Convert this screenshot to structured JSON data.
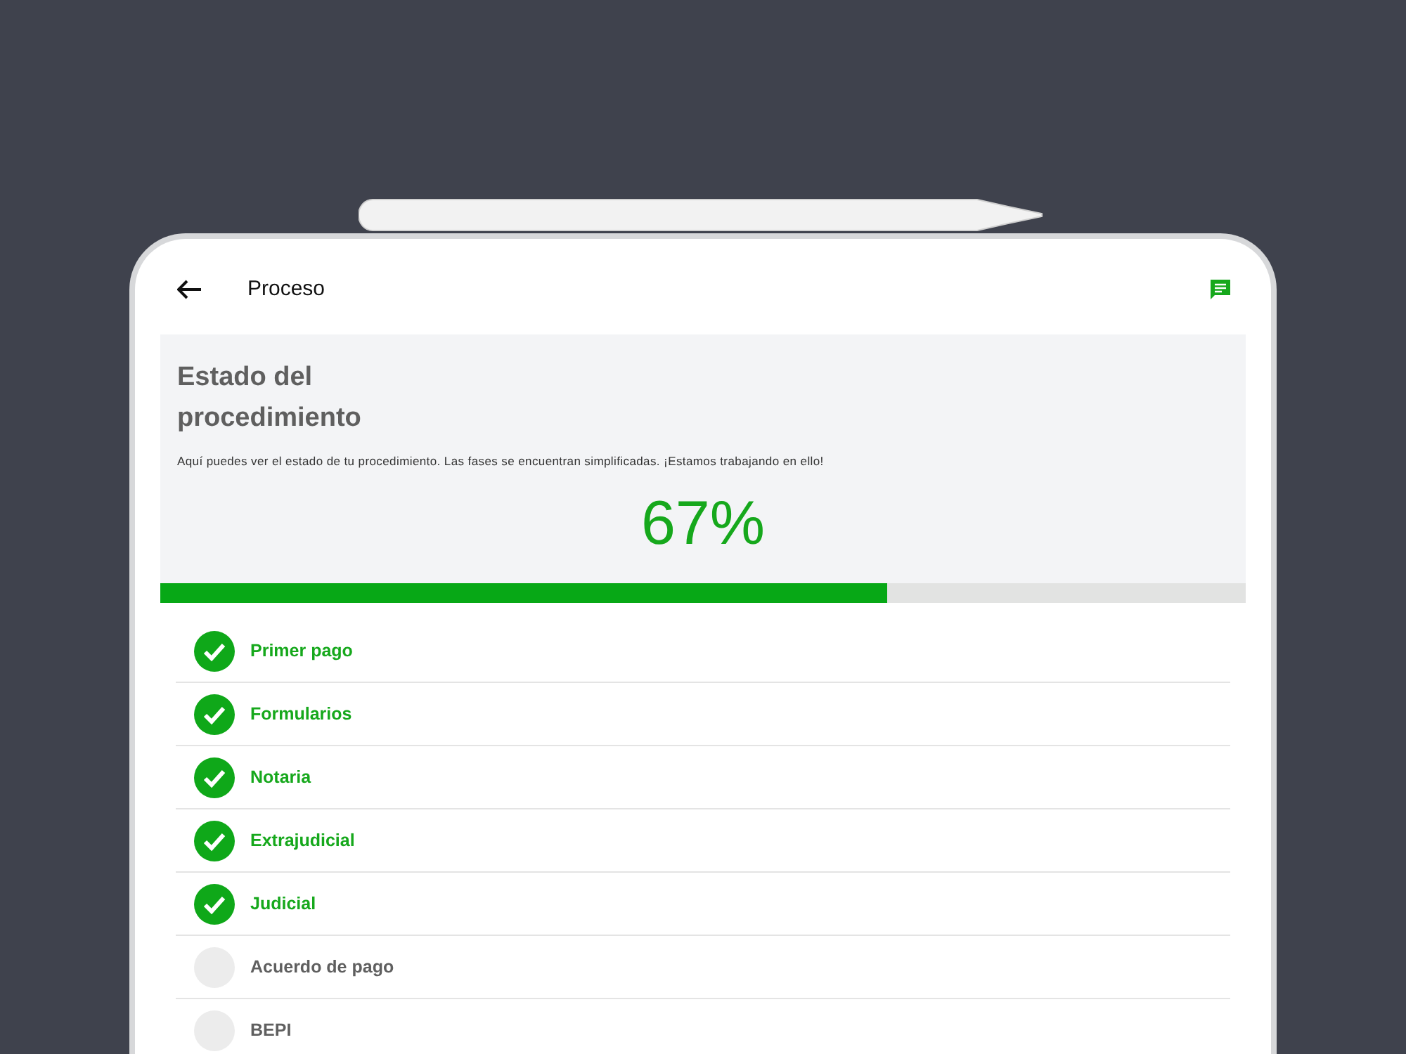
{
  "header": {
    "title": "Proceso"
  },
  "status": {
    "title": "Estado del procedimiento",
    "description": "Aquí puedes ver el estado de tu procedimiento. Las fases se encuentran simplificadas. ¡Estamos trabajando en ello!",
    "percent": "67%"
  },
  "progress": {
    "level": 0.67
  },
  "phases": [
    {
      "label": "Primer pago",
      "done": true
    },
    {
      "label": "Formularios",
      "done": true
    },
    {
      "label": "Notaria",
      "done": true
    },
    {
      "label": "Extrajudicial",
      "done": true
    },
    {
      "label": "Judicial",
      "done": true
    },
    {
      "label": "Acuerdo de pago",
      "done": false
    },
    {
      "label": "BEPI",
      "done": false
    }
  ]
}
